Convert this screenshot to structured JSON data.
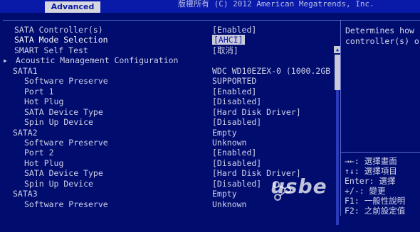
{
  "header": {
    "copyright": "版權所有 (C) 2012 American Megatrends, Inc.",
    "active_tab": "Advanced"
  },
  "rows": [
    {
      "label": "SATA Controller(s)",
      "value": "[Enabled]",
      "indent": 0
    },
    {
      "label": "SATA Mode Selection",
      "value": "[AHCI]",
      "indent": 0,
      "selected": true
    },
    {
      "label": "SMART Self Test",
      "value": "[取消]",
      "indent": 0
    },
    {
      "label": "Acoustic Management Configuration",
      "value": "",
      "indent": 0,
      "submenu": true
    },
    {
      "label": "SATA1",
      "value": "WDC WD10EZEX-0 (1000.2GB",
      "indent": 0
    },
    {
      "label": "Software Preserve",
      "value": "SUPPORTED",
      "indent": 1
    },
    {
      "label": "Port 1",
      "value": "[Enabled]",
      "indent": 1
    },
    {
      "label": "Hot Plug",
      "value": "[Disabled]",
      "indent": 1
    },
    {
      "label": "SATA Device Type",
      "value": "[Hard Disk Driver]",
      "indent": 1
    },
    {
      "label": "Spin Up Device",
      "value": "[Disabled]",
      "indent": 1
    },
    {
      "label": "SATA2",
      "value": "Empty",
      "indent": 0
    },
    {
      "label": "Software Preserve",
      "value": "Unknown",
      "indent": 1
    },
    {
      "label": "Port 2",
      "value": "[Enabled]",
      "indent": 1
    },
    {
      "label": "Hot Plug",
      "value": "[Disabled]",
      "indent": 1
    },
    {
      "label": "SATA Device Type",
      "value": "[Hard Disk Driver]",
      "indent": 1
    },
    {
      "label": "Spin Up Device",
      "value": "[Disabled]",
      "indent": 1
    },
    {
      "label": "SATA3",
      "value": "Empty",
      "indent": 0
    },
    {
      "label": "Software Preserve",
      "value": "Unknown",
      "indent": 1
    }
  ],
  "help": {
    "line1": "Determines how",
    "line2": "controller(s) o"
  },
  "keys": {
    "k1": "→←: 選擇畫面",
    "k2": "↑↓: 選擇項目",
    "k3": "Enter: 選擇",
    "k4": "+/-: 變更",
    "k5": "F1: 一般性說明",
    "k6": "F2: 之前設定值"
  },
  "watermark": "usbe"
}
